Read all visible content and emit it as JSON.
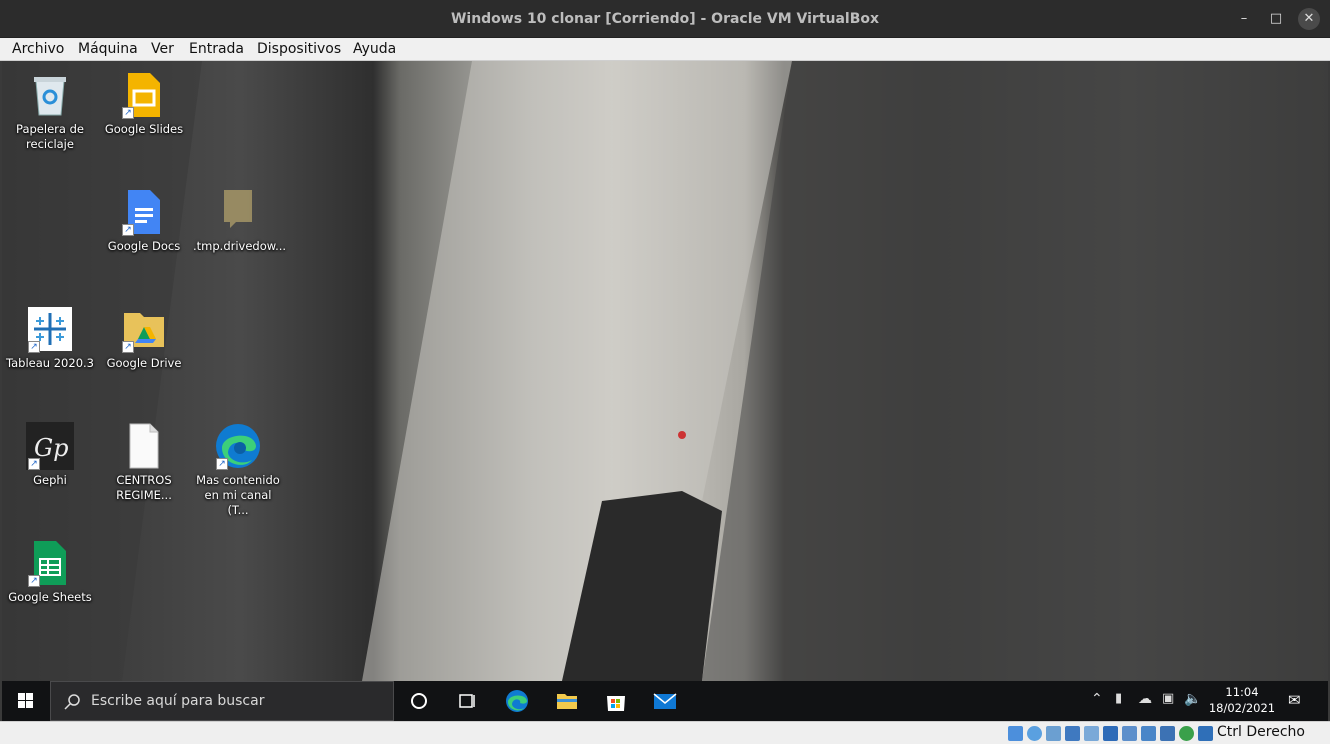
{
  "window": {
    "title": "Windows 10 clonar [Corriendo] - Oracle VM VirtualBox"
  },
  "menu": [
    "Archivo",
    "Máquina",
    "Ver",
    "Entrada",
    "Dispositivos",
    "Ayuda"
  ],
  "desktop_icons": [
    {
      "label": "Papelera de reciclaje",
      "icon": "recycle-bin-icon"
    },
    {
      "label": "Google Slides",
      "icon": "google-slides-icon"
    },
    {
      "label": "Google Docs",
      "icon": "google-docs-icon"
    },
    {
      "label": ".tmp.drivedow...",
      "icon": "folder-icon"
    },
    {
      "label": "Tableau 2020.3",
      "icon": "tableau-icon"
    },
    {
      "label": "Google Drive",
      "icon": "google-drive-icon"
    },
    {
      "label": "Gephi",
      "icon": "gephi-icon"
    },
    {
      "label": "CENTROS REGIME...",
      "icon": "document-icon"
    },
    {
      "label": "Mas contenido en mi canal (T...",
      "icon": "edge-icon"
    },
    {
      "label": "Google Sheets",
      "icon": "google-sheets-icon"
    }
  ],
  "taskbar": {
    "search_placeholder": "Escribe aquí para buscar",
    "time": "11:04",
    "date": "18/02/2021"
  },
  "statusbar": {
    "host_key": "Ctrl Derecho"
  },
  "colors": {
    "taskbar": "#111214",
    "titlebar": "#2c2c2c",
    "menubar": "#f0f0f0"
  }
}
